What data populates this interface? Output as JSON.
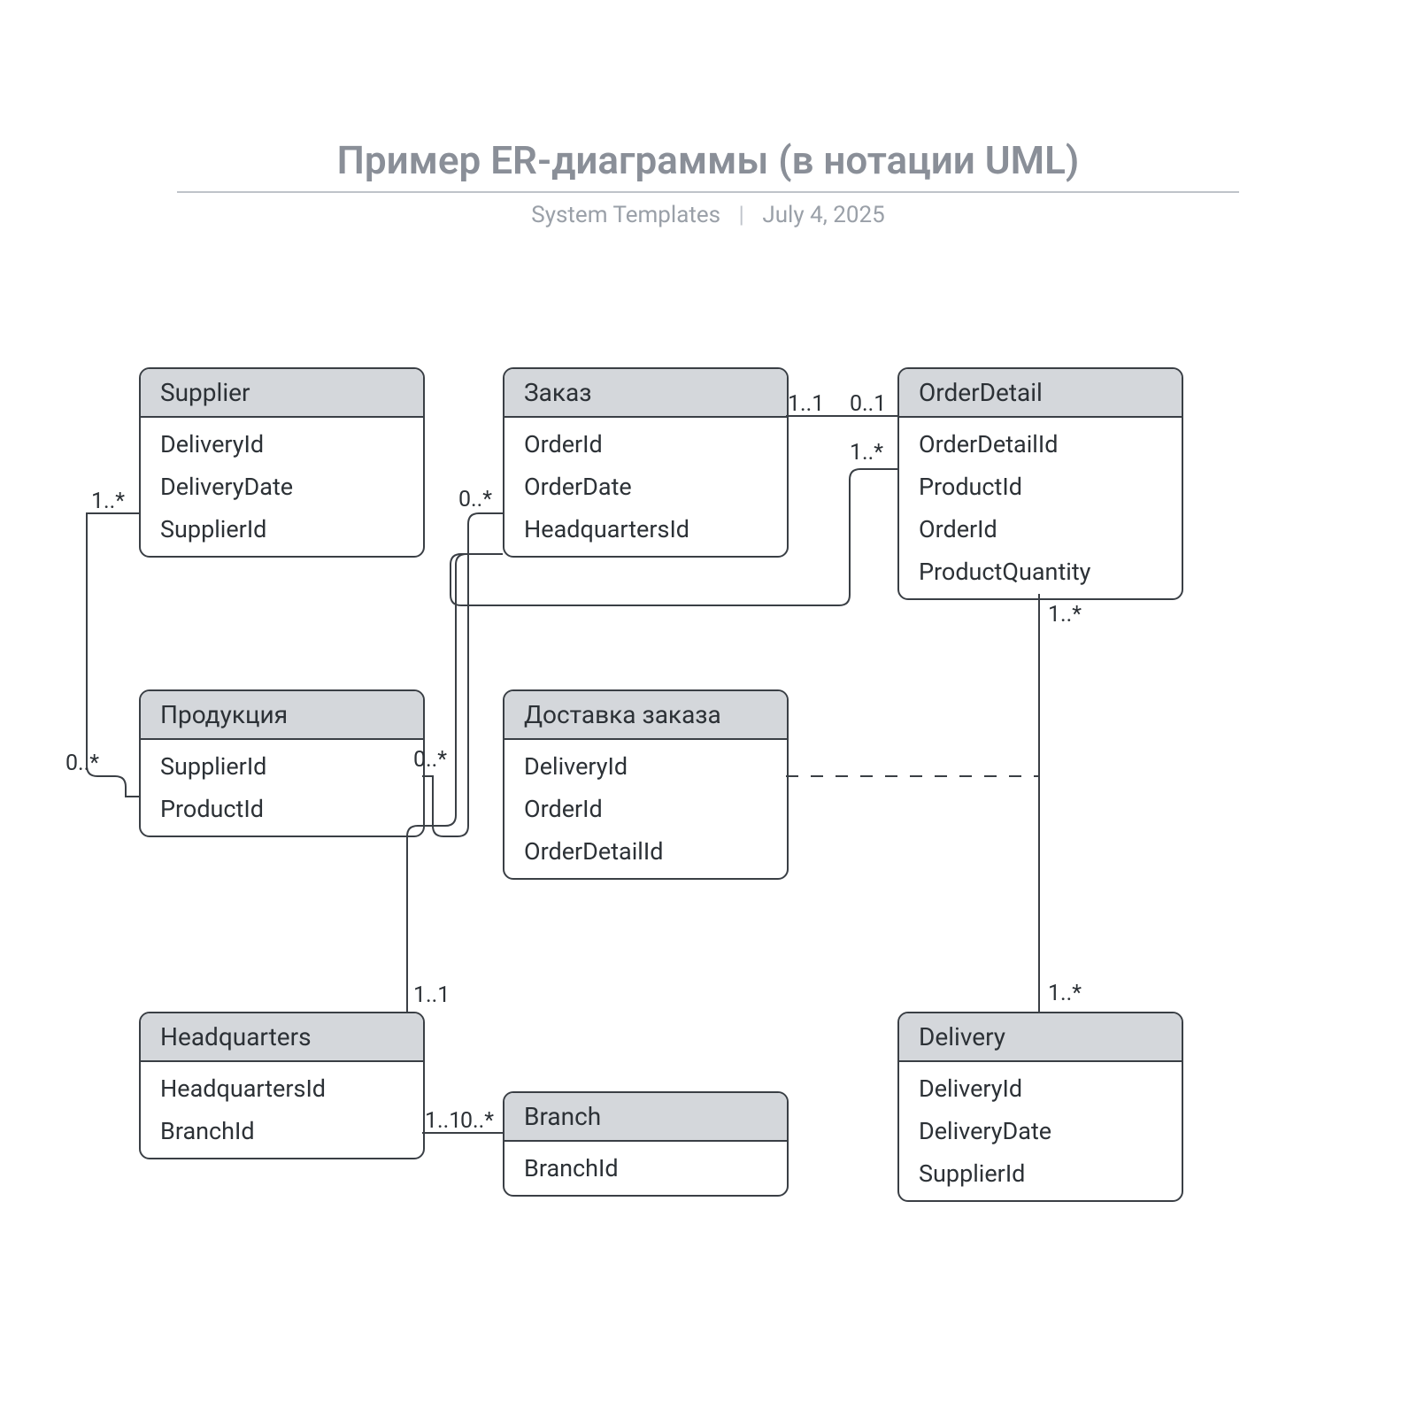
{
  "title": "Пример ER-диаграммы (в нотации UML)",
  "subtitle_left": "System Templates",
  "subtitle_right": "July 4, 2025",
  "entities": {
    "supplier": {
      "name": "Supplier",
      "attrs": [
        "DeliveryId",
        "DeliveryDate",
        "SupplierId"
      ]
    },
    "order": {
      "name": "Заказ",
      "attrs": [
        "OrderId",
        "OrderDate",
        "HeadquartersId"
      ]
    },
    "orderdetail": {
      "name": "OrderDetail",
      "attrs": [
        "OrderDetailId",
        "ProductId",
        "OrderId",
        "ProductQuantity"
      ]
    },
    "product": {
      "name": "Продукция",
      "attrs": [
        "SupplierId",
        "ProductId"
      ]
    },
    "orderdelivery": {
      "name": "Доставка заказа",
      "attrs": [
        "DeliveryId",
        "OrderId",
        "OrderDetailId"
      ]
    },
    "headquarters": {
      "name": "Headquarters",
      "attrs": [
        "HeadquartersId",
        "BranchId"
      ]
    },
    "branch": {
      "name": "Branch",
      "attrs": [
        "BranchId"
      ]
    },
    "delivery": {
      "name": "Delivery",
      "attrs": [
        "DeliveryId",
        "DeliveryDate",
        "SupplierId"
      ]
    }
  },
  "mult": {
    "supplier_product_top": "1..*",
    "supplier_product_bottom": "0..*",
    "order_left": "0..*",
    "order_right": "1..1",
    "orderdetail_left": "0..1",
    "orderdetail_order_src": "1..*",
    "product_right": "0..*",
    "hq_top": "1..1",
    "hq_right": "1..1",
    "branch_left": "0..*",
    "orderdetail_delivery_top": "1..*",
    "orderdetail_delivery_bottom": "1..*"
  }
}
